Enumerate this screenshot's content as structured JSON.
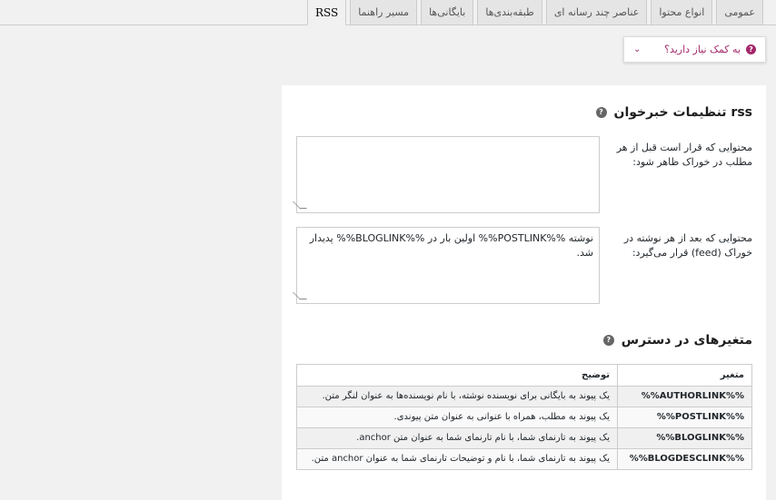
{
  "tabs": [
    {
      "label": "عمومی",
      "active": false
    },
    {
      "label": "انواع محتوا",
      "active": false
    },
    {
      "label": "عناصر چند رسانه ای",
      "active": false
    },
    {
      "label": "طبقه‌بندی‌ها",
      "active": false
    },
    {
      "label": "بایگانی‌ها",
      "active": false
    },
    {
      "label": "مسیر راهنما",
      "active": false
    },
    {
      "label": "RSS",
      "active": true
    }
  ],
  "help": {
    "label": "به کمک نیاز دارید؟",
    "icon": "question-icon"
  },
  "rss": {
    "title": "تنظیمات خبرخوان rss",
    "before_label": "محتوایی که قرار است قبل از هر مطلب در خوراک ظاهر شود:",
    "before_value": "",
    "after_label": "محتوایی که بعد از هر نوشته در خوراک (feed) قرار می‌گیرد:",
    "after_value": "نوشته %%POSTLINK%% اولین بار در %%BLOGLINK%% پدیدار شد."
  },
  "vars": {
    "title": "متغیرهای در دسترس",
    "col_var": "متغیر",
    "col_desc": "توضیح",
    "rows": [
      {
        "var": "%%AUTHORLINK%%",
        "desc": "یک پیوند به بایگانی برای نویسنده نوشته، با نام نویسنده‌ها به عنوان لنگر متن."
      },
      {
        "var": "%%POSTLINK%%",
        "desc": "یک پیوند به مطلب، همراه با عنوانی به عنوان متن پیوندی."
      },
      {
        "var": "%%BLOGLINK%%",
        "desc": "یک پیوند به تارنمای شما، با نام تارنمای شما به عنوان متن anchor."
      },
      {
        "var": "%%BLOGDESCLINK%%",
        "desc": "یک پیوند به تارنمای شما، با نام و توضیحات تارنمای شما به عنوان anchor متن."
      }
    ]
  },
  "colors": {
    "accent": "#a4286a",
    "panel": "#ffffff",
    "background": "#f1f1f1"
  }
}
